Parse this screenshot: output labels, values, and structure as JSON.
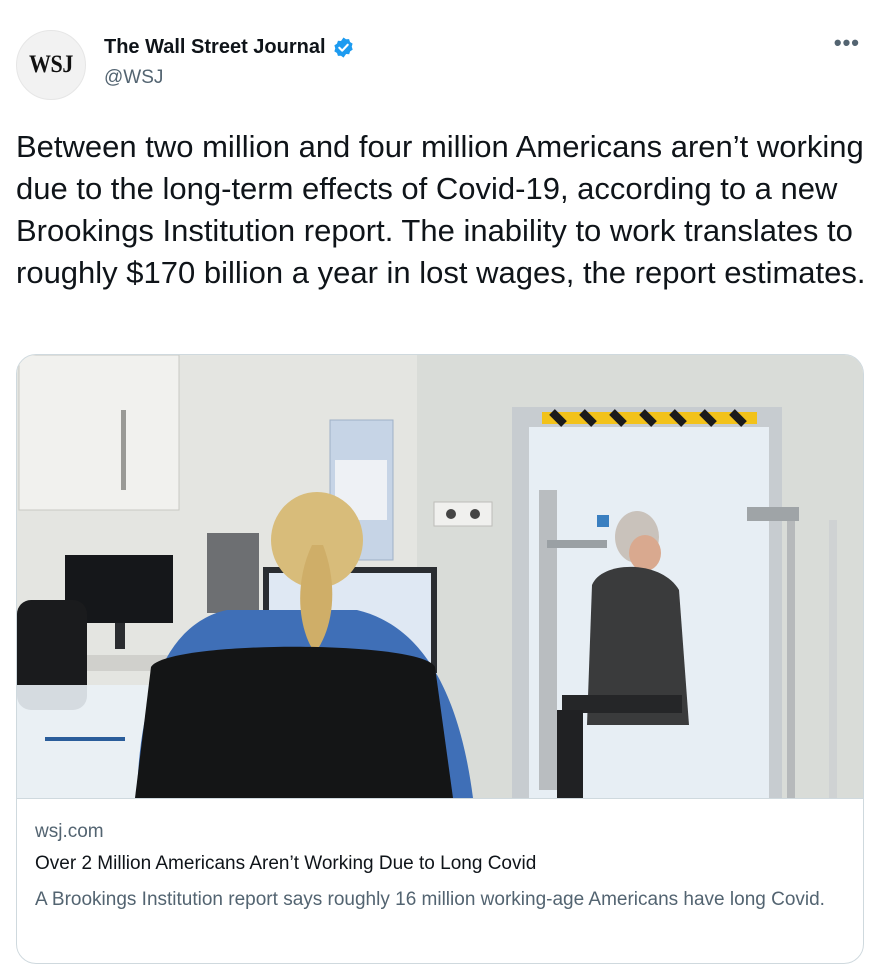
{
  "account": {
    "avatar_text": "WSJ",
    "display_name": "The Wall Street Journal",
    "handle": "@WSJ",
    "verified": true
  },
  "more_menu": {
    "icon": "more-horizontal-icon",
    "label": "•••"
  },
  "tweet": {
    "text": "Between two million and four million Americans aren’t working due to the long-term effects of Covid-19, according to a new Brookings Institution report. The inability to work translates to roughly $170 billion a year in lost wages, the report estimates."
  },
  "link_card": {
    "domain": "wsj.com",
    "title": "Over 2 Million Americans Aren’t Working Due to Long Covid",
    "description": "A Brookings Institution report says roughly 16 million working-age Americans have long Covid."
  },
  "colors": {
    "verified_blue": "#1d9bf0",
    "secondary_text": "#536471",
    "border": "#cfd9de"
  }
}
